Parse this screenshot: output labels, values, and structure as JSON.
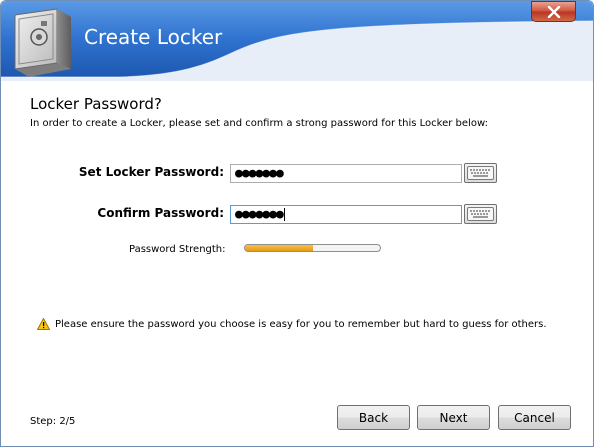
{
  "window": {
    "title": "Create Locker",
    "close_icon": "close-icon"
  },
  "content": {
    "heading": "Locker Password?",
    "intro": "In order to create a Locker, please set and confirm a strong password for this Locker below:"
  },
  "form": {
    "set_password": {
      "label": "Set Locker Password:",
      "value": "●●●●●●●",
      "keyboard_icon": "keyboard-icon"
    },
    "confirm_password": {
      "label": "Confirm Password:",
      "value": "●●●●●●●",
      "keyboard_icon": "keyboard-icon"
    },
    "strength": {
      "label": "Password Strength:",
      "level": 0.5,
      "color": "#e79a12"
    }
  },
  "warning": {
    "icon": "warning-icon",
    "text": "Please ensure the password you choose is easy for you to remember but hard to guess for others."
  },
  "footer": {
    "step": "Step: 2/5",
    "back_label": "Back",
    "next_label": "Next",
    "cancel_label": "Cancel"
  },
  "colors": {
    "header_band": "#2b6fc8",
    "accent": "#1f5fb5"
  }
}
